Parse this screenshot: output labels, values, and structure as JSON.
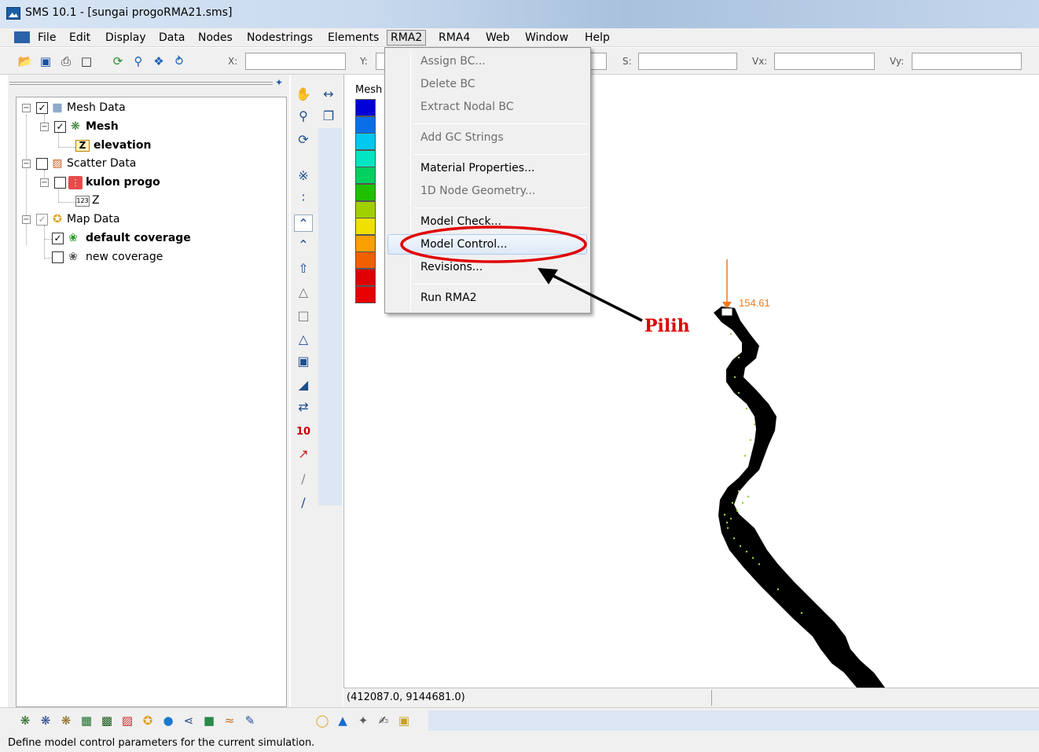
{
  "window": {
    "title": "SMS 10.1 - [sungai progoRMA21.sms]"
  },
  "menubar": {
    "items": [
      "File",
      "Edit",
      "Display",
      "Data",
      "Nodes",
      "Nodestrings",
      "Elements",
      "RMA2",
      "RMA4",
      "Web",
      "Window",
      "Help"
    ],
    "active": "RMA2"
  },
  "toolbar": {
    "coord_labels": {
      "x": "X:",
      "y": "Y:",
      "s": "S:",
      "vx": "Vx:",
      "vy": "Vy:"
    },
    "icons": [
      "open-icon",
      "save-icon",
      "print-icon",
      "delete-icon",
      "refresh-icon",
      "zoom-icon",
      "frame-icon",
      "axes-icon"
    ]
  },
  "tree": {
    "items": [
      {
        "label": "Mesh Data",
        "checked": true
      },
      {
        "label": "Mesh",
        "checked": true
      },
      {
        "label": "elevation"
      },
      {
        "label": "Scatter Data",
        "checked": false
      },
      {
        "label": "kulon progo",
        "checked": false
      },
      {
        "label": "Z"
      },
      {
        "label": "Map Data",
        "checked": true
      },
      {
        "label": "default coverage",
        "checked": true
      },
      {
        "label": "new coverage",
        "checked": false
      }
    ]
  },
  "legend": {
    "title": "Mesh",
    "colors": [
      "#0000d8",
      "#0a6ee8",
      "#00c8f0",
      "#00e6c0",
      "#00d060",
      "#20c000",
      "#a0d000",
      "#f0e000",
      "#f8a000",
      "#f06000",
      "#e00000",
      "#e80000"
    ]
  },
  "dropdown": {
    "items": [
      {
        "label": "Assign BC...",
        "enabled": false
      },
      {
        "label": "Delete BC",
        "enabled": false
      },
      {
        "label": "Extract Nodal BC",
        "enabled": false
      },
      {
        "label": "Add GC Strings",
        "enabled": false
      },
      {
        "label": "Material Properties...",
        "enabled": true
      },
      {
        "label": "1D Node Geometry...",
        "enabled": false
      },
      {
        "label": "Model Check...",
        "enabled": true
      },
      {
        "label": "Model Control...",
        "enabled": true,
        "highlighted": true
      },
      {
        "label": "Revisions...",
        "enabled": true
      },
      {
        "label": "Run RMA2",
        "enabled": true
      }
    ]
  },
  "annotation": {
    "label": "Pilih",
    "color": "#e00000"
  },
  "canvas": {
    "value_label": "154.61",
    "coordinate_readout": "(412087.0, 9144681.0)"
  },
  "status": {
    "message": "Define model control parameters for the current simulation."
  }
}
